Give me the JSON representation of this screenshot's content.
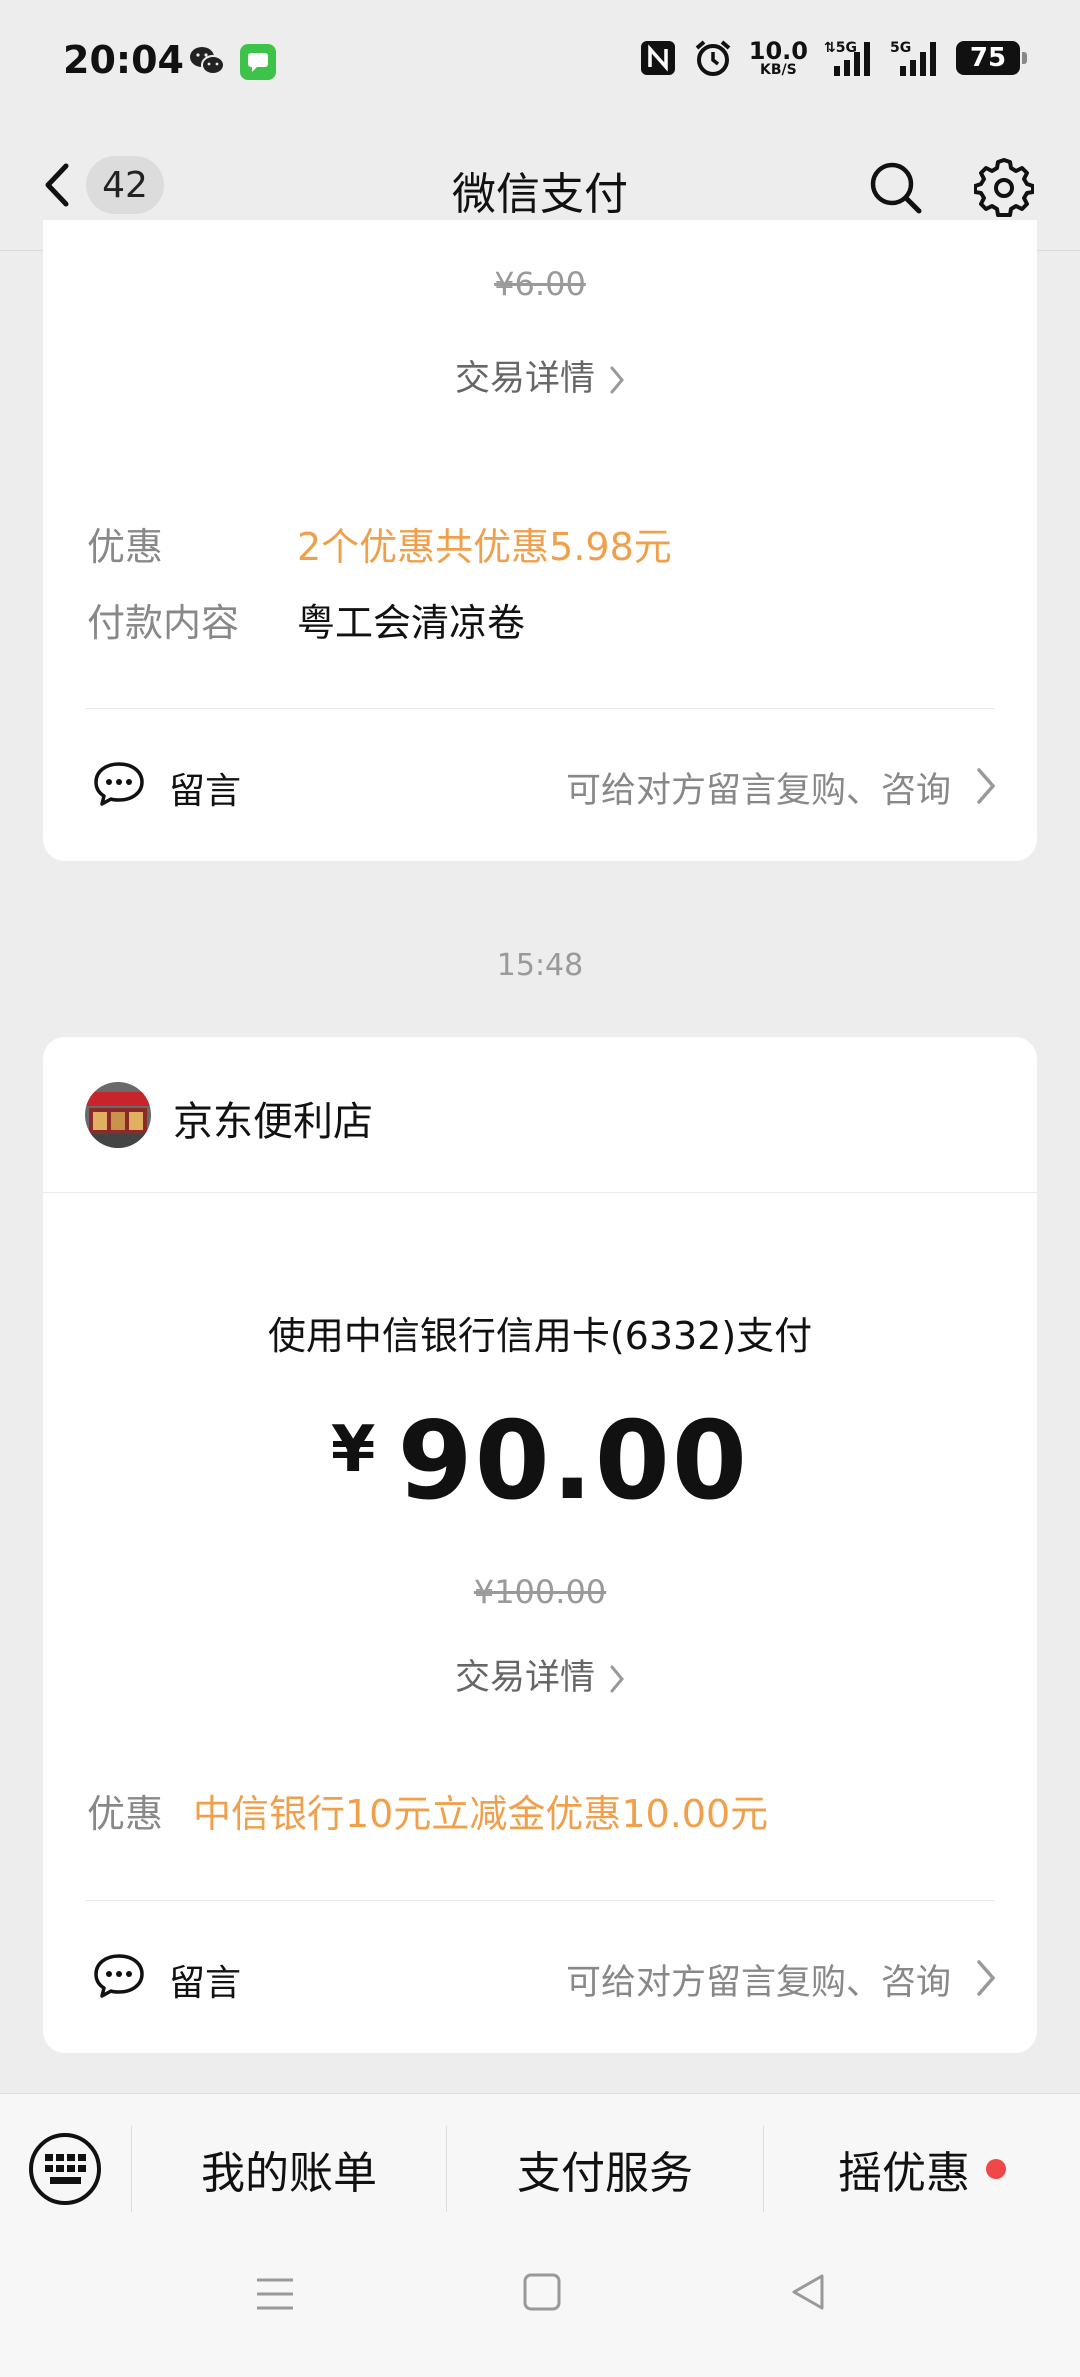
{
  "status_bar": {
    "time": "20:04",
    "net_speed_value": "10.0",
    "net_speed_unit": "KB/S",
    "signal1": "5G",
    "signal2": "5G",
    "battery": "75"
  },
  "header": {
    "back_count": "42",
    "title": "微信支付"
  },
  "card1": {
    "original_price": "¥6.00",
    "detail_link": "交易详情",
    "discount_label": "优惠",
    "discount_value": "2个优惠共优惠5.98元",
    "content_label": "付款内容",
    "content_value": "粤工会清凉卷",
    "message_label": "留言",
    "message_hint": "可给对方留言复购、咨询"
  },
  "time_separator": "15:48",
  "card2": {
    "merchant_name": "京东便利店",
    "pay_method": "使用中信银行信用卡(6332)支付",
    "currency_symbol": "¥",
    "amount": "90.00",
    "original_price": "¥100.00",
    "detail_link": "交易详情",
    "discount_label": "优惠",
    "discount_value": "中信银行10元立减金优惠10.00元",
    "message_label": "留言",
    "message_hint": "可给对方留言复购、咨询"
  },
  "bottom_bar": {
    "tabs": [
      "我的账单",
      "支付服务",
      "摇优惠"
    ]
  },
  "colors": {
    "accent_orange": "#f0a04b",
    "red_dot": "#f04848",
    "background": "#ededed"
  }
}
